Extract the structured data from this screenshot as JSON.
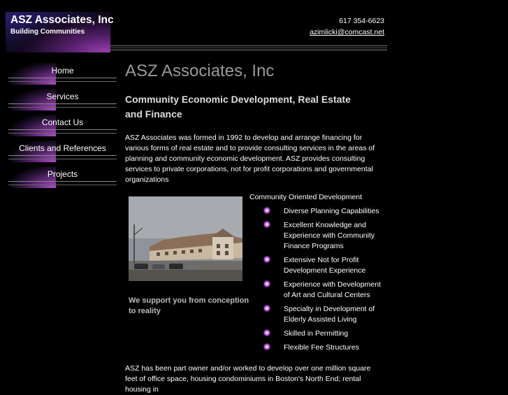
{
  "header": {
    "brand_title": "ASZ Associates, Inc",
    "brand_tagline": "Building Communities",
    "phone": "617 354-6623",
    "email": "azimlicki@comcast.net"
  },
  "nav": {
    "items": [
      {
        "label": "Home"
      },
      {
        "label": "Services"
      },
      {
        "label": "Contact Us"
      },
      {
        "label": "Clients and References"
      },
      {
        "label": "Projects"
      }
    ]
  },
  "main": {
    "title": "ASZ Associates, Inc",
    "subhead": "Community  Economic Development, Real Estate and Finance",
    "intro": "ASZ Associates was formed in 1992 to develop and arrange financing for various forms of real estate and to provide consulting services in the areas of planning and community economic development.  ASZ provides consulting services to private corporations, not for profit corporations and governmental organizations",
    "photo_caption": "We support you from conception to reality",
    "features_title": "Community Oriented Development",
    "features": [
      "Diverse Planning Capabilities",
      "Excellent Knowledge and Experience with Community Finance Programs",
      "Extensive Not for Profit Development Experience",
      "Experience with Development of Art and Cultural Centers",
      "Specialty in Development of Elderly Assisted Living",
      "Skilled in Permitting",
      "Flexible Fee Structures"
    ],
    "closing": "ASZ has been part owner and/or worked to develop over one million square feet of office space, housing condominiums in Boston's North End; rental housing in"
  },
  "colors": {
    "background": "#000000",
    "accent_purple": "#9a3fb0",
    "title_gray": "#999999"
  }
}
